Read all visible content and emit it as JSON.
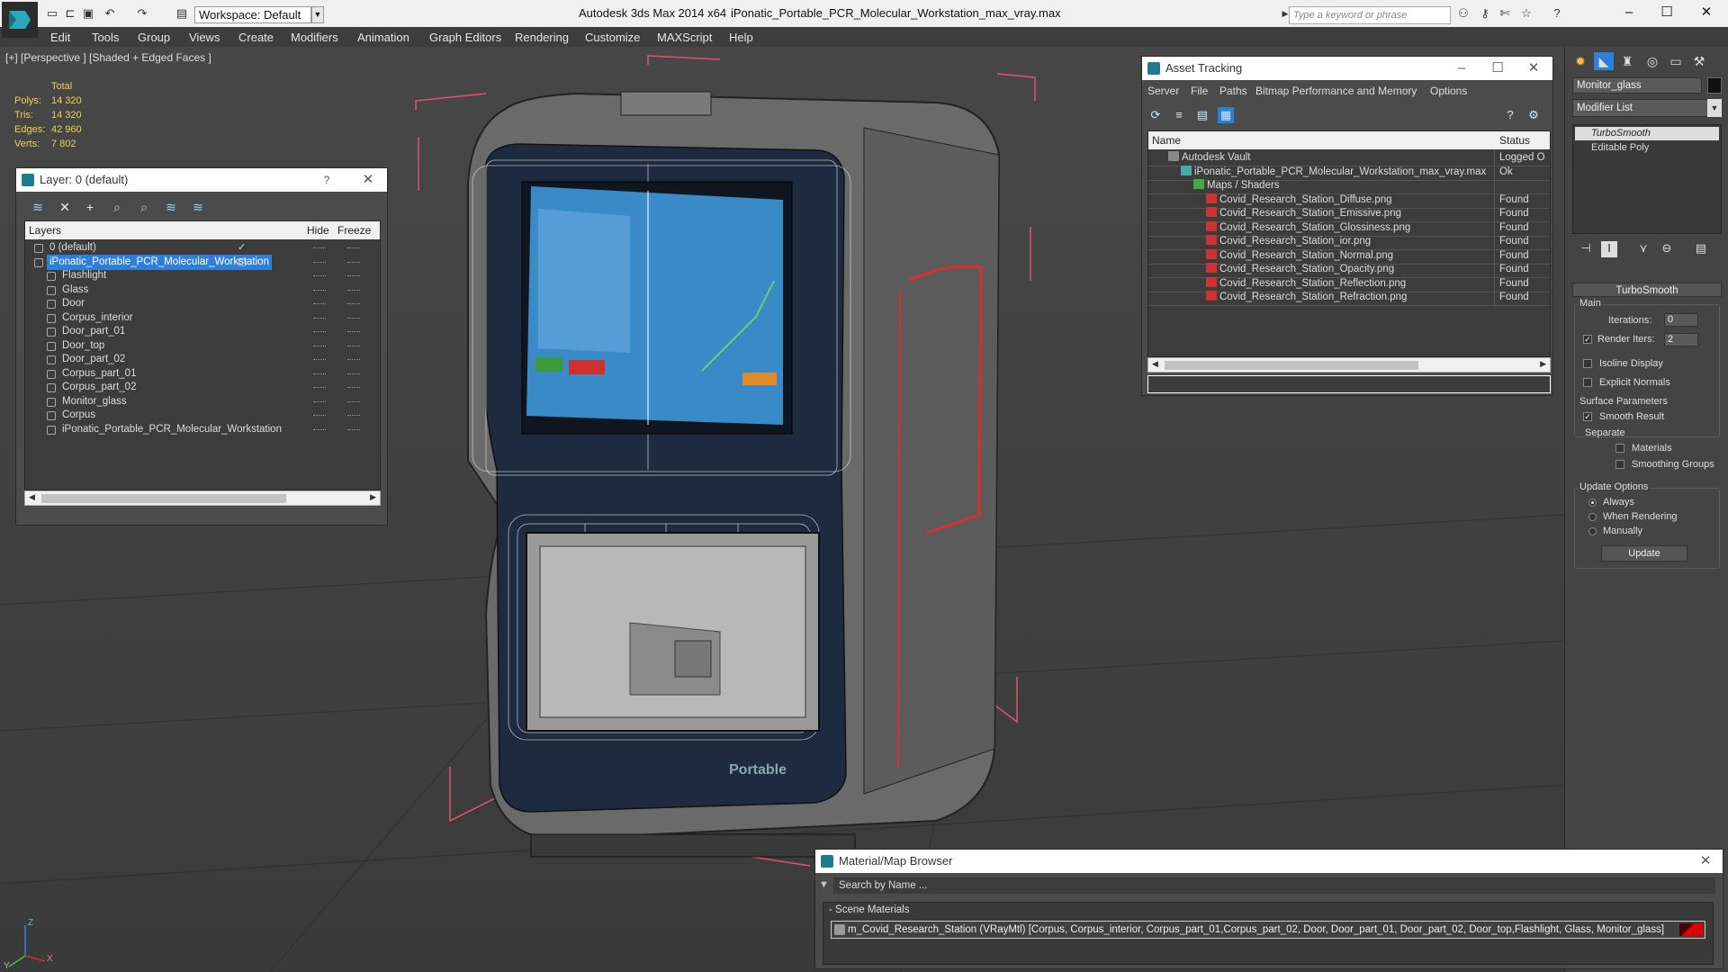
{
  "titlebar": {
    "workspace": "Workspace: Default",
    "app_title": "Autodesk 3ds Max  2014 x64",
    "file_title": "iPonatic_Portable_PCR_Molecular_Workstation_max_vray.max",
    "search_placeholder": "Type a keyword or phrase"
  },
  "menu": [
    "Edit",
    "Tools",
    "Group",
    "Views",
    "Create",
    "Modifiers",
    "Animation",
    "Graph Editors",
    "Rendering",
    "Customize",
    "MAXScript",
    "Help"
  ],
  "viewport": {
    "label": "[+] [Perspective ] [Shaded + Edged Faces ]",
    "stats": {
      "header": "Total",
      "rows": [
        {
          "label": "Polys:",
          "value": "14 320"
        },
        {
          "label": "Tris:",
          "value": "14 320"
        },
        {
          "label": "Edges:",
          "value": "42 960"
        },
        {
          "label": "Verts:",
          "value": "7 802"
        }
      ]
    },
    "axis_labels": {
      "x": "X",
      "y": "Y",
      "z": "Z"
    }
  },
  "layer_panel": {
    "title": "Layer: 0 (default)",
    "help": "?",
    "columns": {
      "layers": "Layers",
      "hide": "Hide",
      "freeze": "Freeze"
    },
    "rows": [
      {
        "name": "0 (default)",
        "level": 0,
        "checked": true,
        "selected": false
      },
      {
        "name": "iPonatic_Portable_PCR_Molecular_Workstation",
        "level": 0,
        "checked": false,
        "selected": true
      },
      {
        "name": "Flashlight",
        "level": 1,
        "selected": false
      },
      {
        "name": "Glass",
        "level": 1,
        "selected": false
      },
      {
        "name": "Door",
        "level": 1,
        "selected": false
      },
      {
        "name": "Corpus_interior",
        "level": 1,
        "selected": false
      },
      {
        "name": "Door_part_01",
        "level": 1,
        "selected": false
      },
      {
        "name": "Door_top",
        "level": 1,
        "selected": false
      },
      {
        "name": "Door_part_02",
        "level": 1,
        "selected": false
      },
      {
        "name": "Corpus_part_01",
        "level": 1,
        "selected": false
      },
      {
        "name": "Corpus_part_02",
        "level": 1,
        "selected": false
      },
      {
        "name": "Monitor_glass",
        "level": 1,
        "selected": false
      },
      {
        "name": "Corpus",
        "level": 1,
        "selected": false
      },
      {
        "name": "iPonatic_Portable_PCR_Molecular_Workstation",
        "level": 1,
        "selected": false
      }
    ]
  },
  "asset_panel": {
    "title": "Asset Tracking",
    "menu": [
      "Server",
      "File",
      "Paths",
      "Bitmap Performance and Memory",
      "Options"
    ],
    "columns": {
      "name": "Name",
      "status": "Status"
    },
    "rows": [
      {
        "name": "Autodesk Vault",
        "status": "Logged O",
        "indent": 1,
        "type": "vault"
      },
      {
        "name": "iPonatic_Portable_PCR_Molecular_Workstation_max_vray.max",
        "status": "Ok",
        "indent": 2,
        "type": "max"
      },
      {
        "name": "Maps / Shaders",
        "status": "",
        "indent": 3,
        "type": "folder"
      },
      {
        "name": "Covid_Research_Station_Diffuse.png",
        "status": "Found",
        "indent": 4,
        "type": "png"
      },
      {
        "name": "Covid_Research_Station_Emissive.png",
        "status": "Found",
        "indent": 4,
        "type": "png"
      },
      {
        "name": "Covid_Research_Station_Glossiness.png",
        "status": "Found",
        "indent": 4,
        "type": "png"
      },
      {
        "name": "Covid_Research_Station_ior.png",
        "status": "Found",
        "indent": 4,
        "type": "png"
      },
      {
        "name": "Covid_Research_Station_Normal.png",
        "status": "Found",
        "indent": 4,
        "type": "png"
      },
      {
        "name": "Covid_Research_Station_Opacity.png",
        "status": "Found",
        "indent": 4,
        "type": "png"
      },
      {
        "name": "Covid_Research_Station_Reflection.png",
        "status": "Found",
        "indent": 4,
        "type": "png"
      },
      {
        "name": "Covid_Research_Station_Refraction.png",
        "status": "Found",
        "indent": 4,
        "type": "png"
      }
    ]
  },
  "command_panel": {
    "object_name": "Monitor_glass",
    "modifier_list": "Modifier List",
    "stack": [
      "TurboSmooth",
      "Editable Poly"
    ],
    "rollout_title": "TurboSmooth",
    "main_label": "Main",
    "iterations_label": "Iterations:",
    "iterations_value": "0",
    "render_iters_label": "Render Iters:",
    "render_iters_value": "2",
    "render_iters_checked": true,
    "isoline_display": "Isoline Display",
    "explicit_normals": "Explicit Normals",
    "surface_params": "Surface Parameters",
    "smooth_result": "Smooth Result",
    "separate": "Separate",
    "materials": "Materials",
    "smoothing_groups": "Smoothing Groups",
    "update_options": "Update Options",
    "always": "Always",
    "when_rendering": "When Rendering",
    "manually": "Manually",
    "update_button": "Update"
  },
  "material_browser": {
    "title": "Material/Map Browser",
    "search_placeholder": "Search by Name ...",
    "section": "- Scene Materials",
    "material_entry": "m_Covid_Research_Station (VRayMtl) [Corpus, Corpus_interior, Corpus_part_01,Corpus_part_02, Door, Door_part_01, Door_part_02, Door_top,Flashlight, Glass, Monitor_glass]"
  },
  "colors": {
    "selection_blue": "#2e7fd8",
    "stats_yellow": "#f0d050",
    "bounding_box_pink": "#e05070",
    "device_body": "#6a6a6a",
    "screen_blue": "#3a8ac8"
  }
}
